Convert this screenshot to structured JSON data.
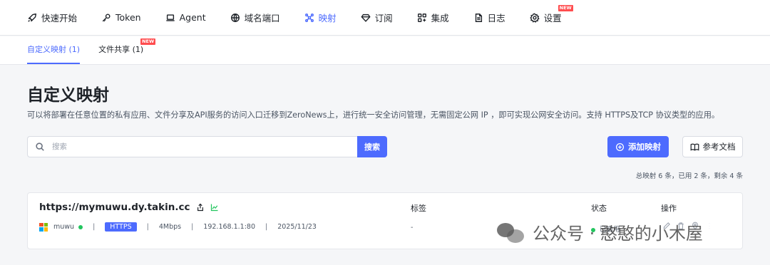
{
  "nav": {
    "items": [
      {
        "label": "快速开始",
        "icon": "rocket-icon"
      },
      {
        "label": "Token",
        "icon": "key-icon"
      },
      {
        "label": "Agent",
        "icon": "laptop-icon"
      },
      {
        "label": "域名端口",
        "icon": "globe-icon"
      },
      {
        "label": "映射",
        "icon": "hub-icon",
        "active": true
      },
      {
        "label": "订阅",
        "icon": "diamond-icon"
      },
      {
        "label": "集成",
        "icon": "grid-plus-icon"
      },
      {
        "label": "日志",
        "icon": "document-icon"
      },
      {
        "label": "设置",
        "icon": "gear-icon",
        "badge": "NEW"
      }
    ]
  },
  "subnav": {
    "tabs": [
      {
        "label": "自定义映射 (1)",
        "active": true
      },
      {
        "label": "文件共享 (1)",
        "badge": "NEW"
      }
    ]
  },
  "page": {
    "title": "自定义映射",
    "description": "可以将部署在任意位置的私有应用、文件分享及API服务的访问入口迁移到ZeroNews上，进行统一安全访问管理，无需固定公网 IP ，即可实现公网安全访问。支持 HTTPS及TCP 协议类型的应用。"
  },
  "search": {
    "placeholder": "搜索",
    "button_label": "搜索"
  },
  "actions": {
    "add_label": "添加映射",
    "docs_label": "参考文档"
  },
  "summary": "总映射 6 条，已用 2 条，剩余 4 条",
  "mapping": {
    "url": "https://mymuwu.dy.takin.cc",
    "agent": "muwu",
    "protocol": "HTTPS",
    "bandwidth": "4Mbps",
    "target": "192.168.1.1:80",
    "date": "2025/11/23",
    "tag_header": "标签",
    "tag_value": "-",
    "status_header": "状态",
    "status_value": "已启用",
    "ops_header": "操作",
    "separator": "|"
  },
  "watermark": {
    "text": "公众号 · 憨憨的小木屋"
  },
  "colors": {
    "accent": "#4d6bfe",
    "online": "#22c55e",
    "badge": "#ff4d4f"
  }
}
